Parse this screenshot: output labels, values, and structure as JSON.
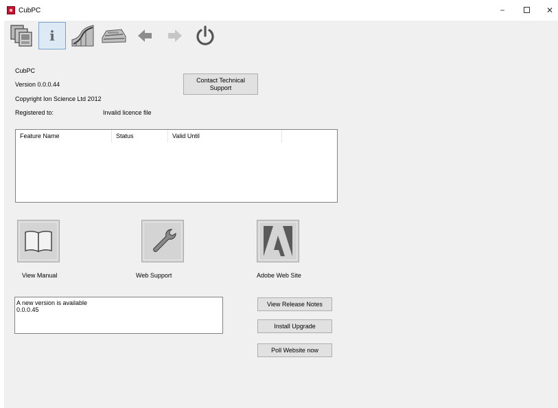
{
  "window": {
    "title": "CubPC",
    "min_glyph": "−",
    "close_glyph": "✕"
  },
  "toolbar": {
    "icons": [
      "instruments-icon",
      "info-icon",
      "curve-graph-icon",
      "instrument-device-icon",
      "back-arrow-icon",
      "forward-arrow-icon",
      "power-icon"
    ],
    "info_glyph": "i"
  },
  "about": {
    "app_name": "CubPC",
    "version": "Version 0.0.0.44",
    "copyright": "Copyright Ion Science Ltd 2012",
    "registered_label": "Registered to:",
    "registered_value": "Invalid licence file",
    "contact_button_line1": "Contact Technical",
    "contact_button_line2": "Support"
  },
  "features_table": {
    "columns": [
      "Feature Name",
      "Status",
      "Valid Until"
    ],
    "rows": []
  },
  "links": {
    "manual_label": "View Manual",
    "web_support_label": "Web Support",
    "adobe_label": "Adobe Web Site"
  },
  "upgrade": {
    "message_line1": "A new version is available",
    "message_line2": "0.0.0.45",
    "release_notes_button": "View Release Notes",
    "install_button": "Install Upgrade",
    "poll_button": "Poll Website now"
  }
}
